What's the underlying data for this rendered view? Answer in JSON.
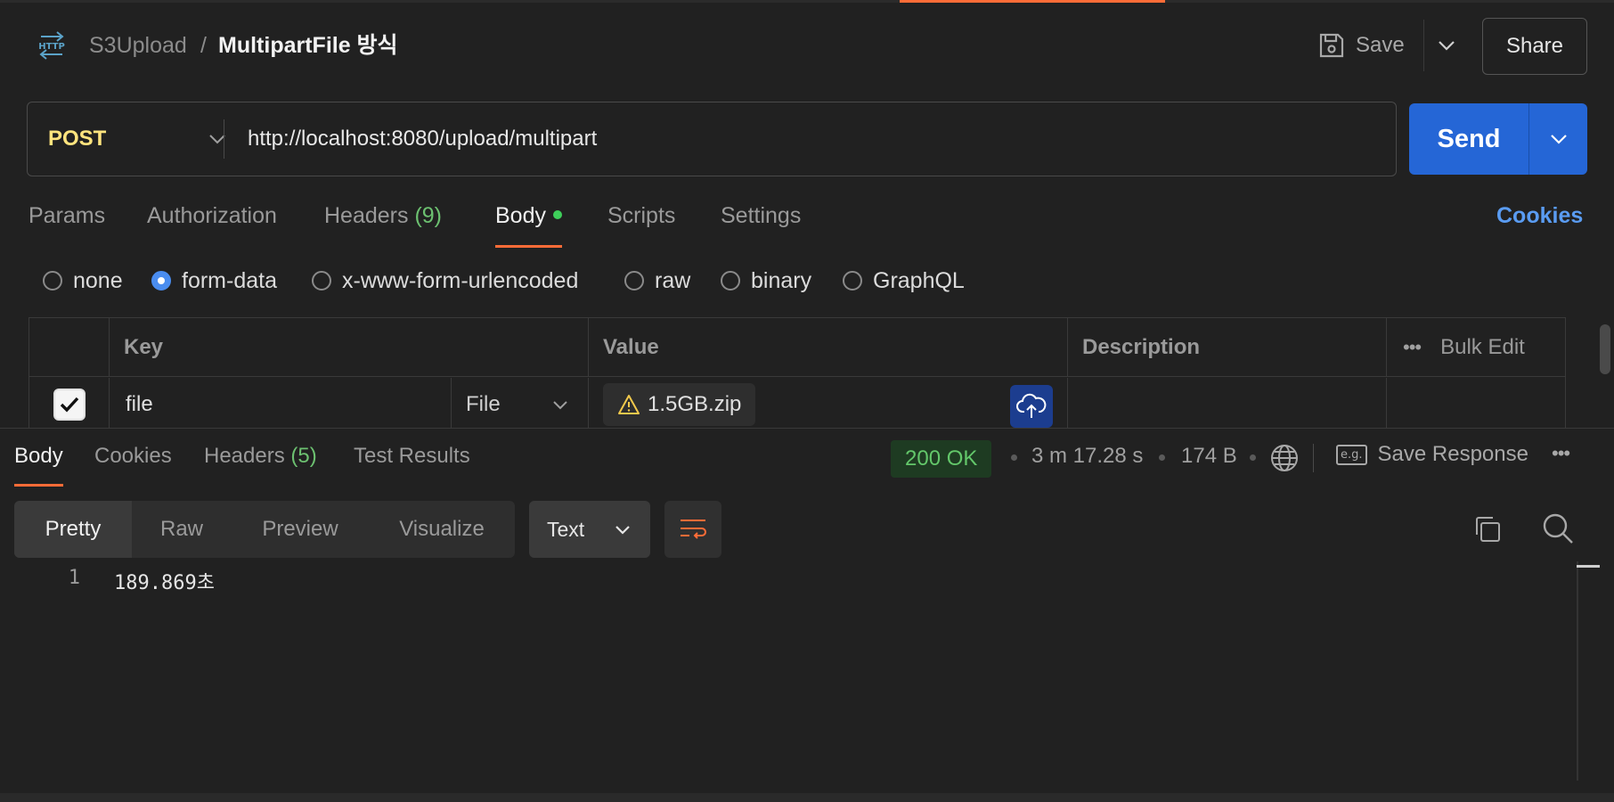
{
  "header": {
    "collection": "S3Upload",
    "separator": "/",
    "request_name": "MultipartFile 방식",
    "save_label": "Save",
    "share_label": "Share"
  },
  "request": {
    "method": "POST",
    "url": "http://localhost:8080/upload/multipart",
    "send_label": "Send"
  },
  "request_tabs": {
    "params": "Params",
    "authorization": "Authorization",
    "headers": "Headers",
    "headers_count": "(9)",
    "body": "Body",
    "scripts": "Scripts",
    "settings": "Settings",
    "cookies": "Cookies"
  },
  "body_types": [
    "none",
    "form-data",
    "x-www-form-urlencoded",
    "raw",
    "binary",
    "GraphQL"
  ],
  "body_type_selected": "form-data",
  "form_table": {
    "headers": {
      "key": "Key",
      "value": "Value",
      "description": "Description",
      "bulk_edit": "Bulk Edit"
    },
    "rows": [
      {
        "checked": true,
        "key": "file",
        "type": "File",
        "value": "1.5GB.zip",
        "description": ""
      }
    ]
  },
  "response_tabs": {
    "body": "Body",
    "cookies": "Cookies",
    "headers": "Headers",
    "headers_count": "(5)",
    "test_results": "Test Results"
  },
  "response_meta": {
    "status": "200 OK",
    "time": "3 m 17.28 s",
    "size": "174 B",
    "save_response": "Save Response",
    "eg_label": "e.g."
  },
  "view_modes": [
    "Pretty",
    "Raw",
    "Preview",
    "Visualize"
  ],
  "view_selected": "Pretty",
  "format": "Text",
  "response_body": [
    {
      "line": "1",
      "text": "189.869초"
    }
  ],
  "colors": {
    "accent": "#ff6c37",
    "send": "#2566d6",
    "method": "#ffe47e",
    "status_ok": "#63c76a",
    "link": "#5a9cf2"
  }
}
